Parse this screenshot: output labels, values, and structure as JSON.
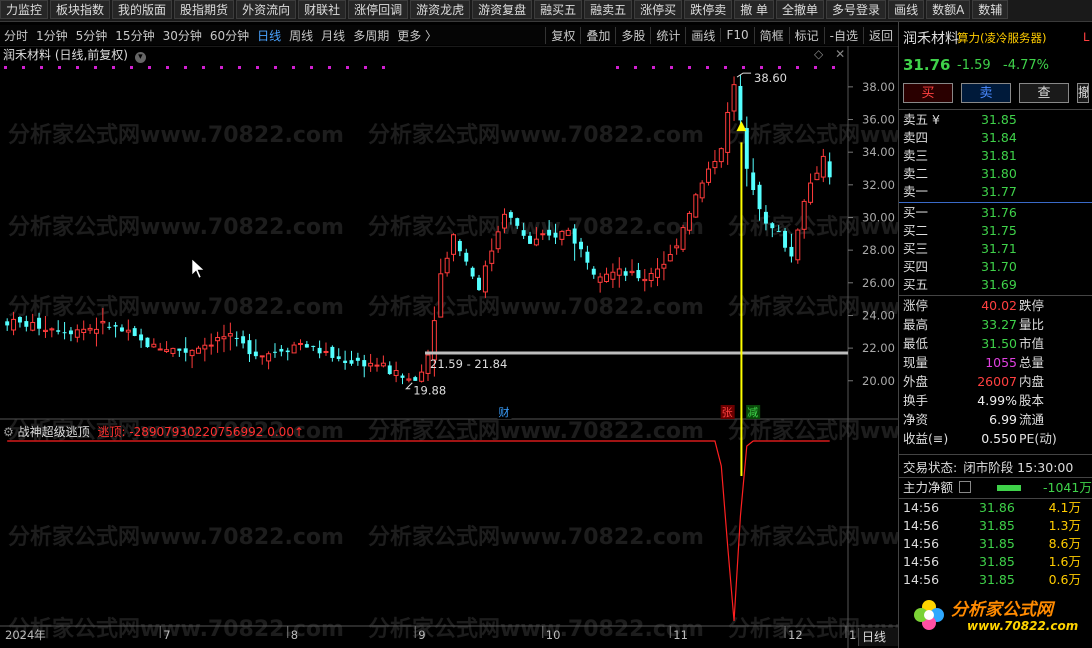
{
  "toolbar": {
    "buttons": [
      "力监控",
      "板块指数",
      "我的版面",
      "股指期货",
      "外资流向",
      "财联社",
      "涨停回调",
      "游资龙虎",
      "游资复盘",
      "融买五",
      "融卖五",
      "涨停买",
      "跌停卖",
      "撤 单",
      "全撤单",
      "多号登录",
      "画线",
      "数额A",
      "数辅"
    ]
  },
  "periodbar": {
    "items": [
      "分时",
      "1分钟",
      "5分钟",
      "15分钟",
      "30分钟",
      "60分钟",
      "日线",
      "周线",
      "月线",
      "多周期",
      "更多 〉"
    ],
    "active": "日线",
    "right_items": [
      "复权",
      "叠加",
      "多股",
      "统计",
      "画线",
      "F10",
      "简框",
      "标记",
      "-自选",
      "返回"
    ]
  },
  "chart_title": "润禾材料 (日线,前复权)",
  "chart_data": {
    "type": "candlestick",
    "stock": "润禾材料",
    "period": "日线",
    "y_ticks": [
      38.0,
      36.0,
      34.0,
      32.0,
      30.0,
      28.0,
      26.0,
      24.0,
      22.0,
      20.0
    ],
    "ylim": [
      18.7,
      39.4
    ],
    "x_ticks": [
      "2024年",
      "7",
      "8",
      "9",
      "10",
      "11",
      "12",
      "1"
    ],
    "annotations": {
      "high_label": "38.60",
      "low_label": "19.88",
      "range_label": "21.59 - 21.84",
      "markers": [
        "财",
        "张",
        "减"
      ]
    },
    "n_candles": 130,
    "price_path": [
      [
        0,
        23.6
      ],
      [
        10,
        23.1
      ],
      [
        16,
        23.4
      ],
      [
        22,
        22.2
      ],
      [
        28,
        21.8
      ],
      [
        34,
        22.7
      ],
      [
        40,
        21.6
      ],
      [
        46,
        22.3
      ],
      [
        52,
        21.3
      ],
      [
        58,
        21.0
      ],
      [
        62,
        20.2
      ],
      [
        64,
        20.0
      ],
      [
        66,
        21.6
      ],
      [
        68,
        26.5
      ],
      [
        70,
        28.9
      ],
      [
        74,
        25.7
      ],
      [
        78,
        30.4
      ],
      [
        82,
        28.4
      ],
      [
        88,
        29.2
      ],
      [
        92,
        26.8
      ],
      [
        100,
        26.3
      ],
      [
        104,
        27.6
      ],
      [
        108,
        31.3
      ],
      [
        112,
        34.4
      ],
      [
        114,
        38.1
      ],
      [
        116,
        33.3
      ],
      [
        119,
        29.5
      ],
      [
        121,
        29.0
      ],
      [
        123,
        27.6
      ],
      [
        125,
        31.2
      ],
      [
        128,
        33.7
      ],
      [
        129,
        32.7
      ]
    ],
    "indicator": {
      "name": "战神超级逃顶",
      "label": "逃顶: -28907930220756992 0.00↑"
    }
  },
  "watermark": "分析家公式网www.70822.com",
  "right_panel": {
    "stock_name": "润禾材料",
    "server": "算力(凌冷服务器)",
    "server_flag": "L",
    "price": "31.76",
    "change": "-1.59",
    "change_pct": "-4.77%",
    "buttons": [
      "买",
      "卖",
      "查",
      "撤"
    ],
    "asks": [
      {
        "label": "卖五 ¥",
        "price": "31.85"
      },
      {
        "label": "卖四",
        "price": "31.84"
      },
      {
        "label": "卖三",
        "price": "31.81"
      },
      {
        "label": "卖二",
        "price": "31.80"
      },
      {
        "label": "卖一",
        "price": "31.77"
      }
    ],
    "bids": [
      {
        "label": "买一",
        "price": "31.76"
      },
      {
        "label": "买二",
        "price": "31.75"
      },
      {
        "label": "买三",
        "price": "31.71"
      },
      {
        "label": "买四",
        "price": "31.70"
      },
      {
        "label": "买五",
        "price": "31.69"
      }
    ],
    "stats": [
      {
        "l": "涨停",
        "v": "40.02",
        "r": "跌停"
      },
      {
        "l": "最高",
        "v": "33.27",
        "r": "量比"
      },
      {
        "l": "最低",
        "v": "31.50",
        "r": "市值"
      },
      {
        "l": "现量",
        "v": "1055",
        "r": "总量"
      },
      {
        "l": "外盘",
        "v": "26007",
        "r": "内盘"
      },
      {
        "l": "换手",
        "v": "4.99%",
        "r": "股本"
      },
      {
        "l": "净资",
        "v": "6.99",
        "r": "流通"
      },
      {
        "l": "收益(≡)",
        "v": "0.550",
        "r": "PE(动)"
      }
    ],
    "status_label": "交易状态:",
    "status_value": "闭市阶段 15:30:00",
    "main_flow_label": "主力净额",
    "main_flow_value": "-1041万",
    "ticks": [
      {
        "t": "14:56",
        "p": "31.86",
        "v": "4.1万"
      },
      {
        "t": "14:56",
        "p": "31.85",
        "v": "1.3万"
      },
      {
        "t": "14:56",
        "p": "31.85",
        "v": "8.6万"
      },
      {
        "t": "14:56",
        "p": "31.85",
        "v": "1.6万"
      },
      {
        "t": "14:56",
        "p": "31.85",
        "v": "0.6万"
      }
    ],
    "logo_text": "分析家公式网",
    "logo_url": "www.70822.com"
  },
  "bottom_tab": "日线"
}
